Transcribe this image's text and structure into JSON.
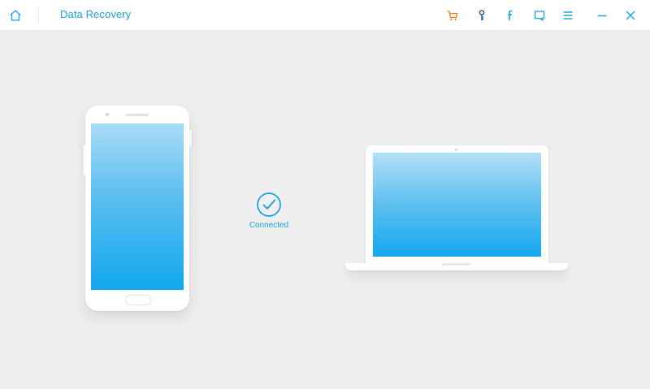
{
  "titlebar": {
    "app_title": "Data Recovery",
    "icons": [
      "home-icon",
      "cart-icon",
      "key-icon",
      "facebook-icon",
      "feedback-icon",
      "menu-icon",
      "minimize-icon",
      "close-icon"
    ]
  },
  "status": {
    "label": "Connected",
    "icon": "check-circle-icon"
  },
  "colors": {
    "accent": "#1aa2e0",
    "cart": "#f07c1e",
    "key": "#1a5a8a",
    "background": "#efefef",
    "screen_top": "#a9dcf7",
    "screen_bottom": "#12a8ef"
  }
}
